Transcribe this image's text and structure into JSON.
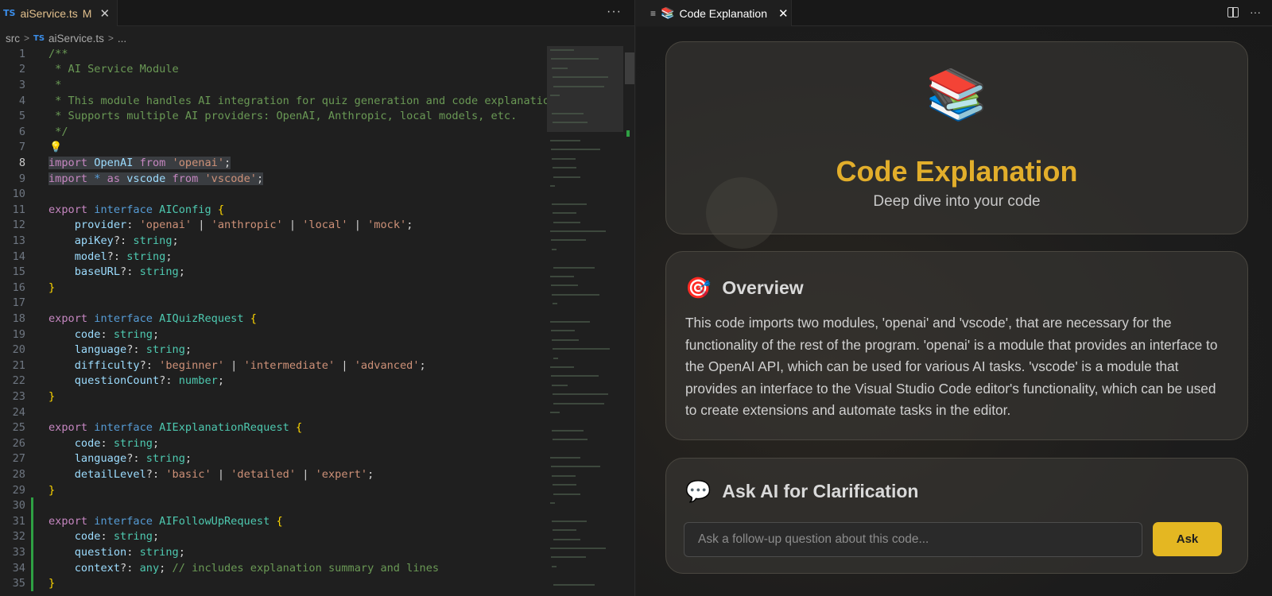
{
  "editor": {
    "tab": {
      "lang_badge": "TS",
      "filename": "aiService.ts",
      "modified": "M",
      "close": "✕"
    },
    "actions_label": "···",
    "breadcrumb": {
      "folder": "src",
      "lang_badge": "TS",
      "file": "aiService.ts",
      "more": "..."
    },
    "lines": [
      {
        "n": "1",
        "tokens": [
          [
            "c-com",
            "/**"
          ]
        ]
      },
      {
        "n": "2",
        "tokens": [
          [
            "c-com",
            " * AI Service Module"
          ]
        ]
      },
      {
        "n": "3",
        "tokens": [
          [
            "c-com",
            " *"
          ]
        ]
      },
      {
        "n": "4",
        "tokens": [
          [
            "c-com",
            " * This module handles AI integration for quiz generation and code explanation."
          ]
        ]
      },
      {
        "n": "5",
        "tokens": [
          [
            "c-com",
            " * Supports multiple AI providers: OpenAI, Anthropic, local models, etc."
          ]
        ]
      },
      {
        "n": "6",
        "tokens": [
          [
            "c-com",
            " */"
          ]
        ]
      },
      {
        "n": "7",
        "tokens": []
      },
      {
        "n": "8",
        "tokens": [
          [
            "c-kw",
            "import"
          ],
          [
            "c-plain",
            " "
          ],
          [
            "c-var",
            "OpenAI"
          ],
          [
            "c-plain",
            " "
          ],
          [
            "c-kw",
            "from"
          ],
          [
            "c-plain",
            " "
          ],
          [
            "c-str",
            "'openai'"
          ],
          [
            "c-plain",
            ";"
          ]
        ],
        "sel": true
      },
      {
        "n": "9",
        "tokens": [
          [
            "c-kw",
            "import"
          ],
          [
            "c-plain",
            " "
          ],
          [
            "c-kw2",
            "*"
          ],
          [
            "c-plain",
            " "
          ],
          [
            "c-kw",
            "as"
          ],
          [
            "c-plain",
            " "
          ],
          [
            "c-var",
            "vscode"
          ],
          [
            "c-plain",
            " "
          ],
          [
            "c-kw",
            "from"
          ],
          [
            "c-plain",
            " "
          ],
          [
            "c-str",
            "'vscode'"
          ],
          [
            "c-plain",
            ";"
          ]
        ],
        "sel": true
      },
      {
        "n": "10",
        "tokens": []
      },
      {
        "n": "11",
        "tokens": [
          [
            "c-kw",
            "export"
          ],
          [
            "c-plain",
            " "
          ],
          [
            "c-kw2",
            "interface"
          ],
          [
            "c-plain",
            " "
          ],
          [
            "c-type",
            "AIConfig"
          ],
          [
            "c-plain",
            " "
          ],
          [
            "c-brace",
            "{"
          ]
        ]
      },
      {
        "n": "12",
        "tokens": [
          [
            "c-plain",
            "    "
          ],
          [
            "c-prop",
            "provider"
          ],
          [
            "c-plain",
            ": "
          ],
          [
            "c-str",
            "'openai'"
          ],
          [
            "c-plain",
            " | "
          ],
          [
            "c-str",
            "'anthropic'"
          ],
          [
            "c-plain",
            " | "
          ],
          [
            "c-str",
            "'local'"
          ],
          [
            "c-plain",
            " | "
          ],
          [
            "c-str",
            "'mock'"
          ],
          [
            "c-plain",
            ";"
          ]
        ]
      },
      {
        "n": "13",
        "tokens": [
          [
            "c-plain",
            "    "
          ],
          [
            "c-prop",
            "apiKey"
          ],
          [
            "c-plain",
            "?: "
          ],
          [
            "c-type",
            "string"
          ],
          [
            "c-plain",
            ";"
          ]
        ]
      },
      {
        "n": "14",
        "tokens": [
          [
            "c-plain",
            "    "
          ],
          [
            "c-prop",
            "model"
          ],
          [
            "c-plain",
            "?: "
          ],
          [
            "c-type",
            "string"
          ],
          [
            "c-plain",
            ";"
          ]
        ]
      },
      {
        "n": "15",
        "tokens": [
          [
            "c-plain",
            "    "
          ],
          [
            "c-prop",
            "baseURL"
          ],
          [
            "c-plain",
            "?: "
          ],
          [
            "c-type",
            "string"
          ],
          [
            "c-plain",
            ";"
          ]
        ]
      },
      {
        "n": "16",
        "tokens": [
          [
            "c-brace",
            "}"
          ]
        ]
      },
      {
        "n": "17",
        "tokens": []
      },
      {
        "n": "18",
        "tokens": [
          [
            "c-kw",
            "export"
          ],
          [
            "c-plain",
            " "
          ],
          [
            "c-kw2",
            "interface"
          ],
          [
            "c-plain",
            " "
          ],
          [
            "c-type",
            "AIQuizRequest"
          ],
          [
            "c-plain",
            " "
          ],
          [
            "c-brace",
            "{"
          ]
        ]
      },
      {
        "n": "19",
        "tokens": [
          [
            "c-plain",
            "    "
          ],
          [
            "c-prop",
            "code"
          ],
          [
            "c-plain",
            ": "
          ],
          [
            "c-type",
            "string"
          ],
          [
            "c-plain",
            ";"
          ]
        ]
      },
      {
        "n": "20",
        "tokens": [
          [
            "c-plain",
            "    "
          ],
          [
            "c-prop",
            "language"
          ],
          [
            "c-plain",
            "?: "
          ],
          [
            "c-type",
            "string"
          ],
          [
            "c-plain",
            ";"
          ]
        ]
      },
      {
        "n": "21",
        "tokens": [
          [
            "c-plain",
            "    "
          ],
          [
            "c-prop",
            "difficulty"
          ],
          [
            "c-plain",
            "?: "
          ],
          [
            "c-str",
            "'beginner'"
          ],
          [
            "c-plain",
            " | "
          ],
          [
            "c-str",
            "'intermediate'"
          ],
          [
            "c-plain",
            " | "
          ],
          [
            "c-str",
            "'advanced'"
          ],
          [
            "c-plain",
            ";"
          ]
        ]
      },
      {
        "n": "22",
        "tokens": [
          [
            "c-plain",
            "    "
          ],
          [
            "c-prop",
            "questionCount"
          ],
          [
            "c-plain",
            "?: "
          ],
          [
            "c-type",
            "number"
          ],
          [
            "c-plain",
            ";"
          ]
        ]
      },
      {
        "n": "23",
        "tokens": [
          [
            "c-brace",
            "}"
          ]
        ]
      },
      {
        "n": "24",
        "tokens": []
      },
      {
        "n": "25",
        "tokens": [
          [
            "c-kw",
            "export"
          ],
          [
            "c-plain",
            " "
          ],
          [
            "c-kw2",
            "interface"
          ],
          [
            "c-plain",
            " "
          ],
          [
            "c-type",
            "AIExplanationRequest"
          ],
          [
            "c-plain",
            " "
          ],
          [
            "c-brace",
            "{"
          ]
        ]
      },
      {
        "n": "26",
        "tokens": [
          [
            "c-plain",
            "    "
          ],
          [
            "c-prop",
            "code"
          ],
          [
            "c-plain",
            ": "
          ],
          [
            "c-type",
            "string"
          ],
          [
            "c-plain",
            ";"
          ]
        ]
      },
      {
        "n": "27",
        "tokens": [
          [
            "c-plain",
            "    "
          ],
          [
            "c-prop",
            "language"
          ],
          [
            "c-plain",
            "?: "
          ],
          [
            "c-type",
            "string"
          ],
          [
            "c-plain",
            ";"
          ]
        ]
      },
      {
        "n": "28",
        "tokens": [
          [
            "c-plain",
            "    "
          ],
          [
            "c-prop",
            "detailLevel"
          ],
          [
            "c-plain",
            "?: "
          ],
          [
            "c-str",
            "'basic'"
          ],
          [
            "c-plain",
            " | "
          ],
          [
            "c-str",
            "'detailed'"
          ],
          [
            "c-plain",
            " | "
          ],
          [
            "c-str",
            "'expert'"
          ],
          [
            "c-plain",
            ";"
          ]
        ]
      },
      {
        "n": "29",
        "tokens": [
          [
            "c-brace",
            "}"
          ]
        ]
      },
      {
        "n": "30",
        "tokens": [],
        "git": true
      },
      {
        "n": "31",
        "tokens": [
          [
            "c-kw",
            "export"
          ],
          [
            "c-plain",
            " "
          ],
          [
            "c-kw2",
            "interface"
          ],
          [
            "c-plain",
            " "
          ],
          [
            "c-type",
            "AIFollowUpRequest"
          ],
          [
            "c-plain",
            " "
          ],
          [
            "c-brace",
            "{"
          ]
        ],
        "git": true
      },
      {
        "n": "32",
        "tokens": [
          [
            "c-plain",
            "    "
          ],
          [
            "c-prop",
            "code"
          ],
          [
            "c-plain",
            ": "
          ],
          [
            "c-type",
            "string"
          ],
          [
            "c-plain",
            ";"
          ]
        ],
        "git": true
      },
      {
        "n": "33",
        "tokens": [
          [
            "c-plain",
            "    "
          ],
          [
            "c-prop",
            "question"
          ],
          [
            "c-plain",
            ": "
          ],
          [
            "c-type",
            "string"
          ],
          [
            "c-plain",
            ";"
          ]
        ],
        "git": true
      },
      {
        "n": "34",
        "tokens": [
          [
            "c-plain",
            "    "
          ],
          [
            "c-prop",
            "context"
          ],
          [
            "c-plain",
            "?: "
          ],
          [
            "c-type",
            "any"
          ],
          [
            "c-plain",
            "; "
          ],
          [
            "c-com",
            "// includes explanation summary and lines"
          ]
        ],
        "git": true
      },
      {
        "n": "35",
        "tokens": [
          [
            "c-brace",
            "}"
          ]
        ],
        "git": true
      }
    ]
  },
  "webview": {
    "tab": {
      "menu_icon": "≡",
      "icon": "📚",
      "title": "Code Explanation",
      "close": "✕"
    },
    "actions": {
      "more": "···"
    },
    "hero": {
      "icon": "📚",
      "title": "Code Explanation",
      "subtitle": "Deep dive into your code"
    },
    "overview": {
      "icon": "🎯",
      "heading": "Overview",
      "text": "This code imports two modules, 'openai' and 'vscode', that are necessary for the functionality of the rest of the program. 'openai' is a module that provides an interface to the OpenAI API, which can be used for various AI tasks. 'vscode' is a module that provides an interface to the Visual Studio Code editor's functionality, which can be used to create extensions and automate tasks in the editor."
    },
    "ask": {
      "icon": "💬",
      "heading": "Ask AI for Clarification",
      "placeholder": "Ask a follow-up question about this code...",
      "button": "Ask"
    }
  },
  "colors": {
    "accent_gold": "#e2ae2b",
    "button_gold": "#e4b722",
    "git_added": "#2ea043"
  }
}
